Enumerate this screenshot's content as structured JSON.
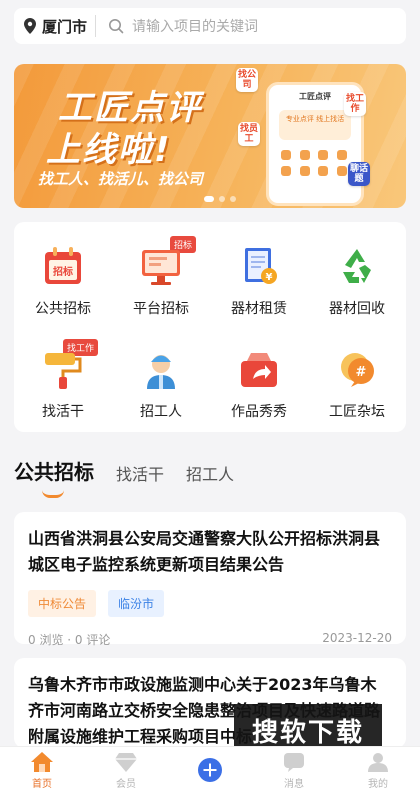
{
  "header": {
    "city": "厦门市",
    "search_placeholder": "请输入项目的关键词"
  },
  "banner": {
    "line1": "工匠点评",
    "line2": "上线啦!",
    "line3": "找工人、找活儿、找公司",
    "phone_title": "工匠点评",
    "phone_card": "专业点评 线上找活",
    "tags": [
      "找公司",
      "找工作",
      "找员工",
      "聊话题"
    ],
    "active_slide": 1
  },
  "grid": {
    "items": [
      {
        "label": "公共招标",
        "icon": "calendar-icon",
        "badge": ""
      },
      {
        "label": "平台招标",
        "icon": "monitor-icon",
        "badge": "招标"
      },
      {
        "label": "器材租赁",
        "icon": "document-icon",
        "badge": ""
      },
      {
        "label": "器材回收",
        "icon": "recycle-icon",
        "badge": ""
      },
      {
        "label": "找活干",
        "icon": "paint-roller-icon",
        "badge": "找工作"
      },
      {
        "label": "招工人",
        "icon": "worker-icon",
        "badge": ""
      },
      {
        "label": "作品秀秀",
        "icon": "share-box-icon",
        "badge": ""
      },
      {
        "label": "工匠杂坛",
        "icon": "chat-bubble-icon",
        "badge": ""
      }
    ]
  },
  "tabs": [
    {
      "label": "公共招标",
      "active": true
    },
    {
      "label": "找活干",
      "active": false
    },
    {
      "label": "招工人",
      "active": false
    }
  ],
  "cards": [
    {
      "title": "山西省洪洞县公安局交通警察大队公开招标洪洞县城区电子监控系统更新项目结果公告",
      "tag1": "中标公告",
      "tag2": "临汾市",
      "stats": "0 浏览 · 0 评论",
      "date": "2023-12-20"
    },
    {
      "title": "乌鲁木齐市市政设施监测中心关于2023年乌鲁木齐市河南路立交桥安全隐患整治项目及快速路道路附属设施维护工程采购项目中标"
    }
  ],
  "watermark": "搜软下载",
  "nav": [
    {
      "label": "首页",
      "icon": "home-icon",
      "active": true
    },
    {
      "label": "会员",
      "icon": "diamond-icon",
      "active": false
    },
    {
      "label": "",
      "icon": "plus-icon",
      "active": false
    },
    {
      "label": "消息",
      "icon": "message-icon",
      "active": false
    },
    {
      "label": "我的",
      "icon": "profile-icon",
      "active": false
    }
  ],
  "colors": {
    "accent": "#f28a2e",
    "badge_red": "#e84a3e",
    "blue": "#3b82e6"
  }
}
